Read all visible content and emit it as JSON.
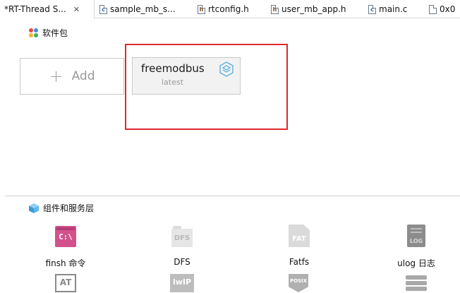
{
  "tabs": [
    {
      "label": "*RT-Thread S...",
      "active": true,
      "closable": true
    },
    {
      "label": "sample_mb_s...",
      "type": "c"
    },
    {
      "label": "rtconfig.h",
      "type": "h"
    },
    {
      "label": "user_mb_app.h",
      "type": "h"
    },
    {
      "label": "main.c",
      "type": "c"
    },
    {
      "label": "0x0",
      "type": "file"
    }
  ],
  "tab_icon_letters": {
    "c": "c",
    "h": "h"
  },
  "close_glyph": "✕",
  "packages_section": {
    "title": "软件包",
    "add_button": {
      "plus": "+",
      "label": "Add"
    },
    "packages": [
      {
        "name": "freemodbus",
        "version": "latest"
      }
    ]
  },
  "components_section": {
    "title": "组件和服务层",
    "items": [
      {
        "label": "finsh 命令",
        "icon": "finsh-icon",
        "icon_text": "C:\\"
      },
      {
        "label": "DFS",
        "icon": "dfs-folder-icon",
        "icon_text": "DFS"
      },
      {
        "label": "Fatfs",
        "icon": "fatfs-file-icon",
        "icon_text": "FAT"
      },
      {
        "label": "ulog 日志",
        "icon": "ulog-log-icon",
        "icon_text": "LOG"
      },
      {
        "label": "",
        "icon": "at-icon",
        "icon_text": "AT"
      },
      {
        "label": "",
        "icon": "lwip-icon",
        "icon_text": "lwIP"
      },
      {
        "label": "",
        "icon": "posix-icon",
        "icon_text": "POSIX"
      },
      {
        "label": "",
        "icon": "stack-icon",
        "icon_text": ""
      }
    ]
  },
  "colors": {
    "highlight": "#e0282e",
    "finsh": "#d2518c",
    "cube_badge": "#5aaee0"
  }
}
